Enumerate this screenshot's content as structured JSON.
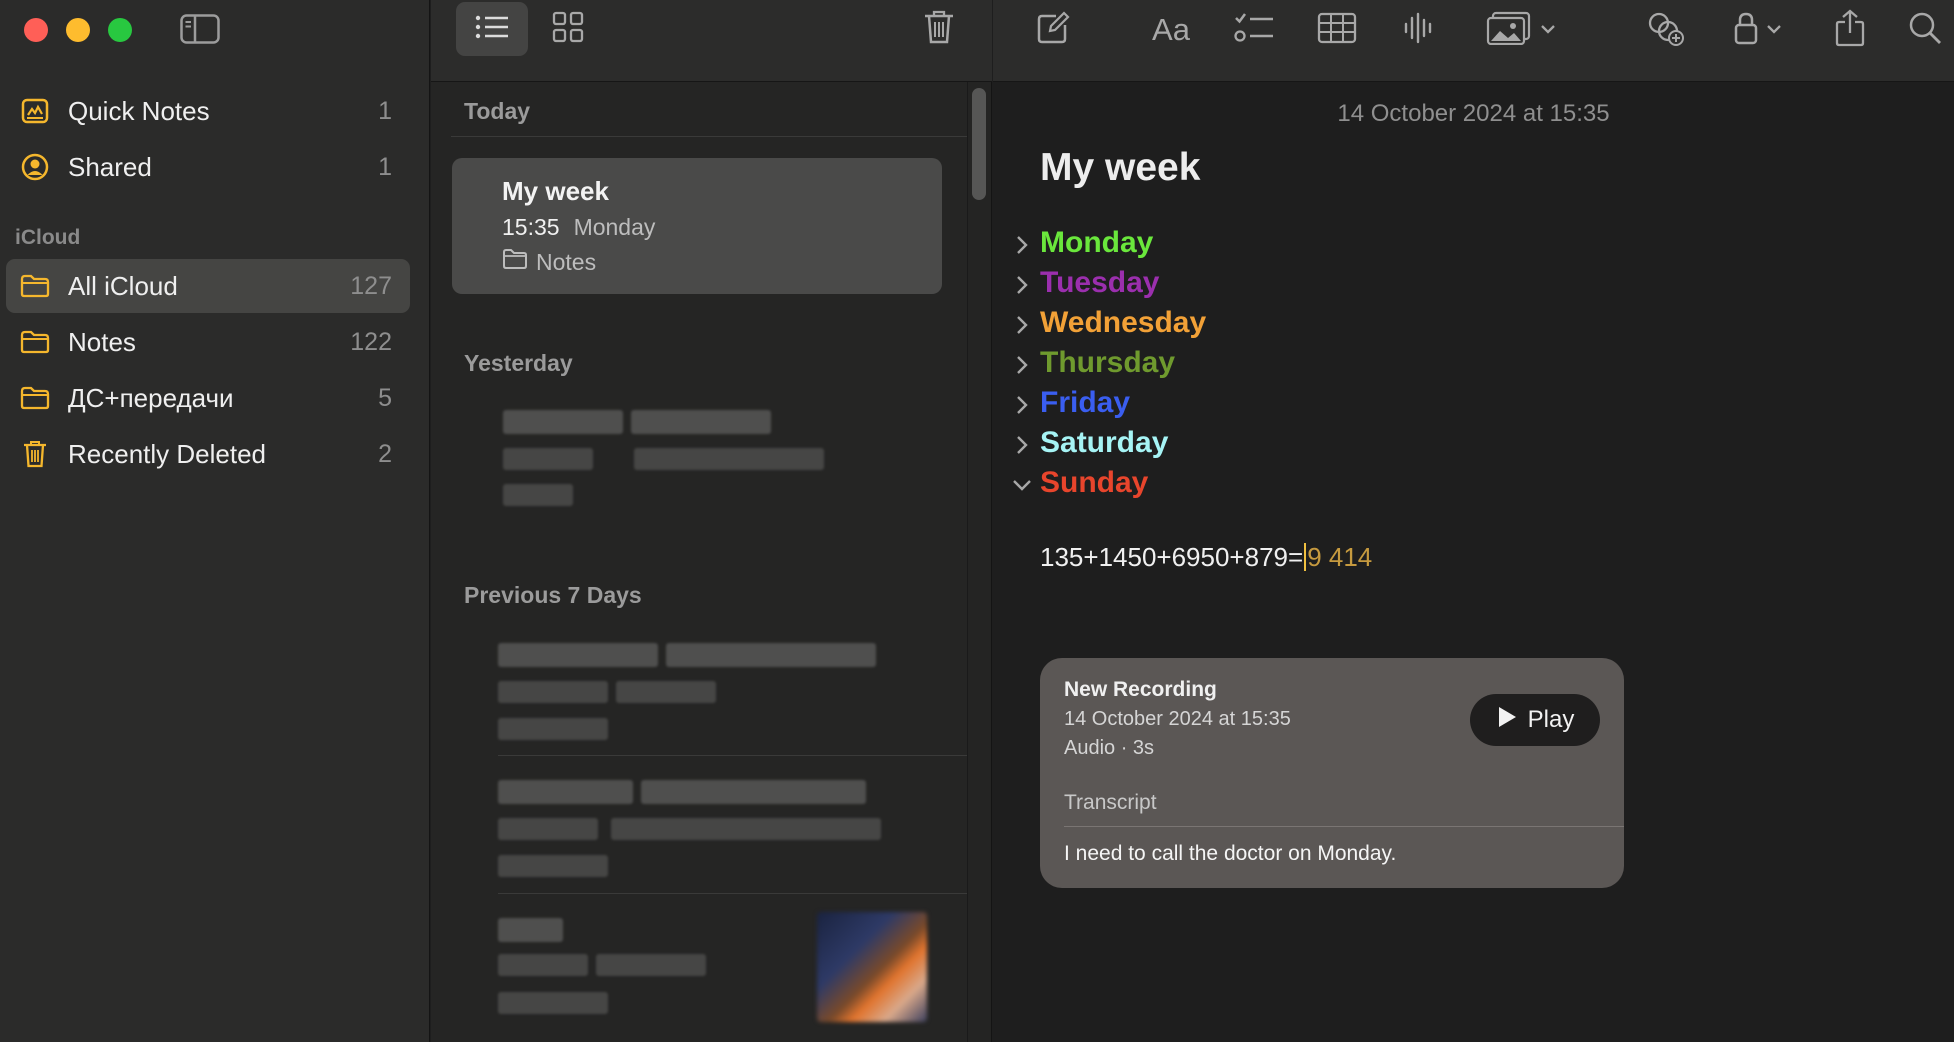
{
  "colors": {
    "accent_folder": "#f5b72d",
    "monday": "#6ae73c",
    "tuesday": "#9b2fae",
    "wednesday": "#f2a137",
    "thursday": "#6f9a2e",
    "friday": "#3a5ef0",
    "saturday": "#a6f4f5",
    "sunday": "#e8452c"
  },
  "sidebar": {
    "toggle_icon": "sidebar-toggle-icon",
    "pinned": [
      {
        "label": "Quick Notes",
        "count": "1",
        "icon": "quick-notes-icon"
      },
      {
        "label": "Shared",
        "count": "1",
        "icon": "shared-person-icon"
      }
    ],
    "section": "iCloud",
    "folders": [
      {
        "label": "All iCloud",
        "count": "127",
        "icon": "folder-icon",
        "selected": true
      },
      {
        "label": "Notes",
        "count": "122",
        "icon": "folder-icon"
      },
      {
        "label": "ДС+передачи",
        "count": "5",
        "icon": "folder-icon"
      },
      {
        "label": "Recently Deleted",
        "count": "2",
        "icon": "trash-icon"
      }
    ]
  },
  "list": {
    "groups": {
      "today": "Today",
      "yesterday": "Yesterday",
      "previous": "Previous 7 Days"
    },
    "selected_note": {
      "title": "My week",
      "time": "15:35",
      "preview": "Monday",
      "folder": "Notes"
    }
  },
  "editor": {
    "date": "14 October 2024 at 15:35",
    "title": "My week",
    "days": [
      "Monday",
      "Tuesday",
      "Wednesday",
      "Thursday",
      "Friday",
      "Saturday",
      "Sunday"
    ],
    "calc_expr": "135+1450+6950+879=",
    "calc_result": "9 414",
    "recording": {
      "title": "New Recording",
      "date": "14 October 2024 at 15:35",
      "meta": "Audio · 3s",
      "play_label": "Play",
      "transcript_label": "Transcript",
      "transcript_text": "I need to call the doctor on Monday."
    }
  }
}
